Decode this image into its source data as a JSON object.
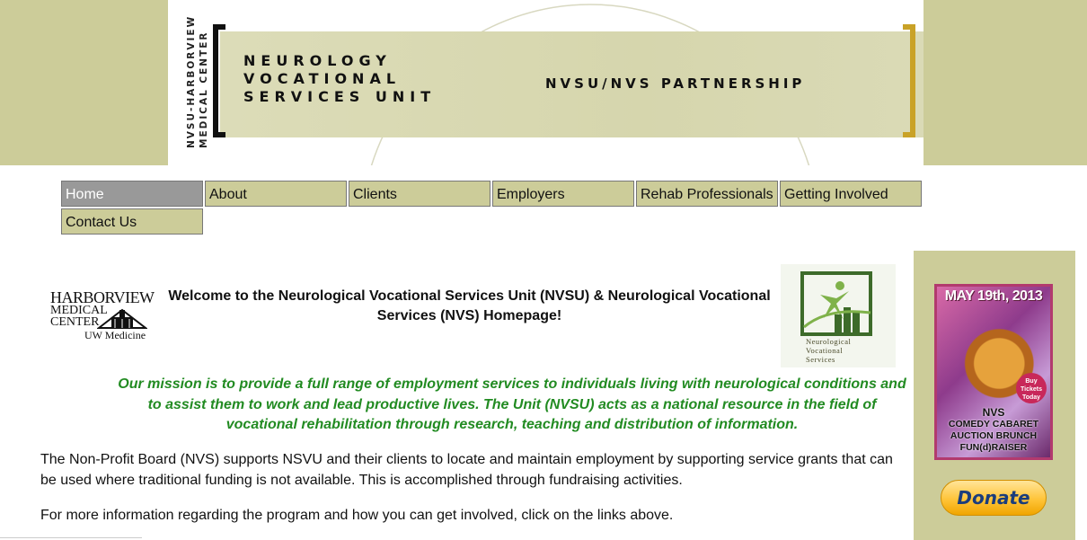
{
  "header": {
    "vertical_text": [
      "NVSU-HARBORVIEW",
      "MEDICAL CENTER"
    ],
    "unit_title_lines": [
      "NEUROLOGY",
      "VOCATIONAL",
      "SERVICES UNIT"
    ],
    "partnership": "NVSU/NVS PARTNERSHIP"
  },
  "nav": {
    "items": [
      {
        "label": "Home"
      },
      {
        "label": "About"
      },
      {
        "label": "Clients"
      },
      {
        "label": "Employers"
      },
      {
        "label": "Rehab Professionals"
      },
      {
        "label": "Getting Involved"
      },
      {
        "label": "Contact Us"
      }
    ],
    "active": "Home"
  },
  "logos": {
    "harborview": {
      "line1": "HARBORVIEW",
      "line2": "MEDICAL",
      "line3": "CENTER",
      "sub": "UW Medicine"
    },
    "nvs": {
      "line1": "Neurological",
      "line2": "Vocational",
      "line3": "Services"
    }
  },
  "main": {
    "welcome": "Welcome to the Neurological Vocational Services Unit (NVSU) & Neurological Vocational Services  (NVS) Homepage!",
    "mission": "Our mission is to provide a full range of employment services to individuals living with neurological conditions and to assist them to work and lead productive lives.  The Unit (NVSU) acts as a national resource in the field of vocational rehabilitation through research, teaching and distribution of information.",
    "paragraph1": "The Non-Profit Board (NVS) supports NSVU and their clients to locate and maintain employment by supporting service grants that can be used where traditional funding is not available. This is accomplished through fundraising activities.",
    "paragraph2": "For more information regarding the program and how you can get involved, click on the links above."
  },
  "sidebar": {
    "poster": {
      "date": "MAY 19th, 2013",
      "badge": "Buy Tickets Today",
      "lines": [
        "NVS",
        "COMEDY CABARET",
        "AUCTION BRUNCH",
        "FUN(d)RAISER"
      ]
    },
    "donate_label": "Donate"
  },
  "colors": {
    "khaki": "#cccc99",
    "nav_active": "#999999",
    "mission_green": "#228b22",
    "donate_text": "#1a3d7c"
  }
}
